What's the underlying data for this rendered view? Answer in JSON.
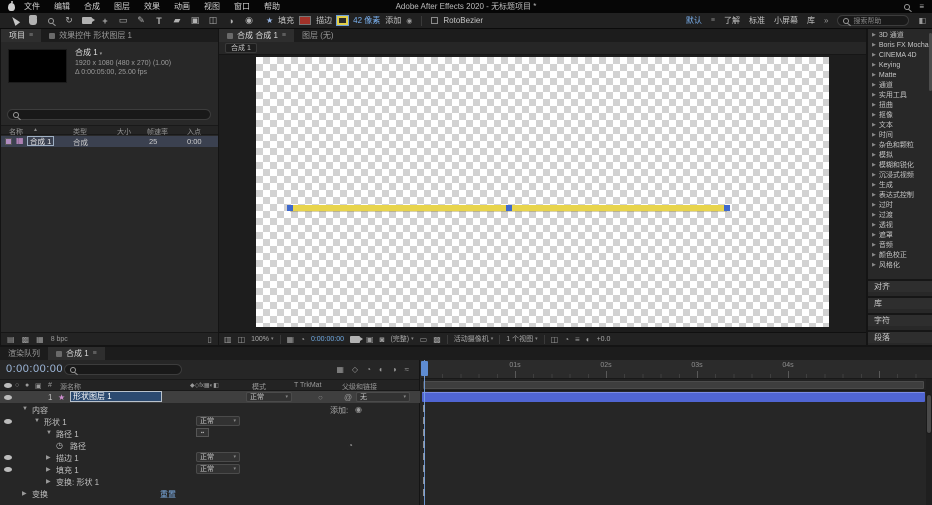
{
  "menubar": {
    "menus": [
      "文件",
      "编辑",
      "合成",
      "图层",
      "效果",
      "动画",
      "视图",
      "窗口",
      "帮助"
    ],
    "title": "Adobe After Effects 2020 - 无标题项目 *"
  },
  "toolbar": {
    "fill_label": "填充",
    "stroke_label": "描边",
    "stroke_width": "42 像素",
    "add_label": "添加",
    "rotobezier_label": "RotoBezier",
    "workspaces": [
      "默认",
      "了解",
      "标准",
      "小屏幕",
      "库"
    ],
    "overflow_chevron": "»",
    "help_search_placeholder": "搜索帮助"
  },
  "project_panel": {
    "tab_project": "项目",
    "tab_effect_controls": "效果控件 形状图层 1",
    "comp_name": "合成 1",
    "comp_info_line1": "1920 x 1080 (480 x 270) (1.00)",
    "comp_info_line2": "Δ 0:00:05:00, 25.00 fps",
    "columns": {
      "name": "名称",
      "type": "类型",
      "size": "大小",
      "frame_rate": "帧速率",
      "in_point": "入点"
    },
    "row": {
      "name": "合成 1",
      "type": "合成",
      "frame_rate": "25",
      "in_point": "0:00"
    },
    "bit_depth": "8 bpc"
  },
  "comp_panel": {
    "tab_composition": "合成 合成 1",
    "tab_layer": "图层 (无)",
    "viewer_tab": "合成 1",
    "statusbar": {
      "zoom": "100%",
      "timecode": "0:00:00:00",
      "resolution": "(完整)",
      "view": "活动摄像机",
      "layout": "1 个视图",
      "exposure": "+0.0"
    }
  },
  "effects_panel": {
    "categories": [
      "3D 通道",
      "Boris FX Mocha",
      "CINEMA 4D",
      "Keying",
      "Matte",
      "通道",
      "实用工具",
      "扭曲",
      "抠像",
      "文本",
      "时间",
      "杂色和颗粒",
      "模拟",
      "模糊和锐化",
      "沉浸式视频",
      "生成",
      "表达式控制",
      "过时",
      "过渡",
      "透视",
      "遮罩",
      "音频",
      "颜色校正",
      "风格化"
    ]
  },
  "side_panels": [
    "对齐",
    "库",
    "字符",
    "段落"
  ],
  "timeline": {
    "tab_render_queue": "渲染队列",
    "tab_comp": "合成 1",
    "timecode": "0:00:00:00",
    "headers": {
      "index": "#",
      "source_name": "源名称",
      "mode": "模式",
      "trkmat": "T TrkMat",
      "parent": "父级和链接"
    },
    "layer": {
      "index": "1",
      "name": "形状图层 1",
      "mode": "正常",
      "parent": "无"
    },
    "props": [
      {
        "label": "内容",
        "right_label": "添加:"
      },
      {
        "label": "形状 1",
        "mode": "正常"
      },
      {
        "label": "路径 1"
      },
      {
        "label": "路径"
      },
      {
        "label": "描边 1",
        "mode": "正常"
      },
      {
        "label": "填充 1",
        "mode": "正常"
      },
      {
        "label": "变换: 形状 1"
      },
      {
        "label": "变换",
        "right_label": "重置"
      }
    ],
    "ruler": [
      "01s",
      "02s",
      "03s",
      "04s"
    ]
  }
}
